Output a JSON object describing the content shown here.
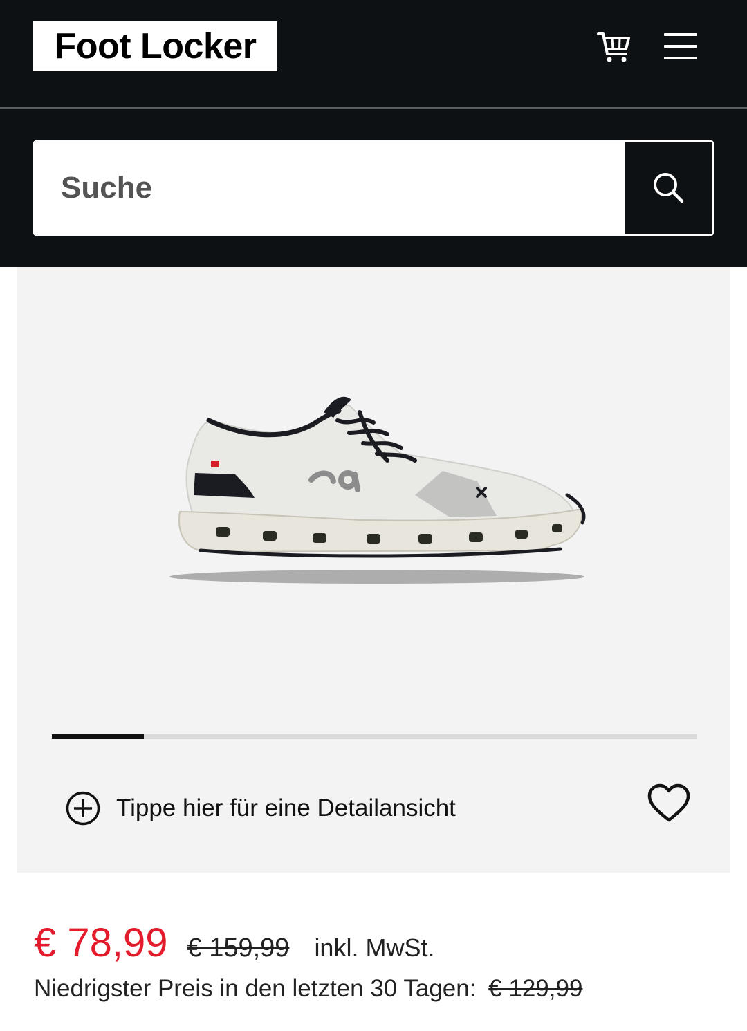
{
  "header": {
    "logo_text": "Foot Locker",
    "background_color": "#0d1113"
  },
  "search": {
    "placeholder": "Suche"
  },
  "gallery": {
    "image_alt": "On Cloud X 3 white sneaker",
    "progress_fraction": 0.143,
    "detail_label": "Tippe hier für eine Detailansicht"
  },
  "price": {
    "current": "€ 78,99",
    "original": "€ 159,99",
    "tax_note": "inkl. MwSt.",
    "lowest_label": "Niedrigster Preis in den letzten 30 Tagen:",
    "lowest_value": "€ 129,99",
    "accent_color": "#e31b2c"
  },
  "icons": {
    "cart": "cart-icon",
    "menu": "hamburger-menu-icon",
    "search": "search-icon",
    "detail": "plus-circle-icon",
    "wishlist": "heart-icon"
  }
}
